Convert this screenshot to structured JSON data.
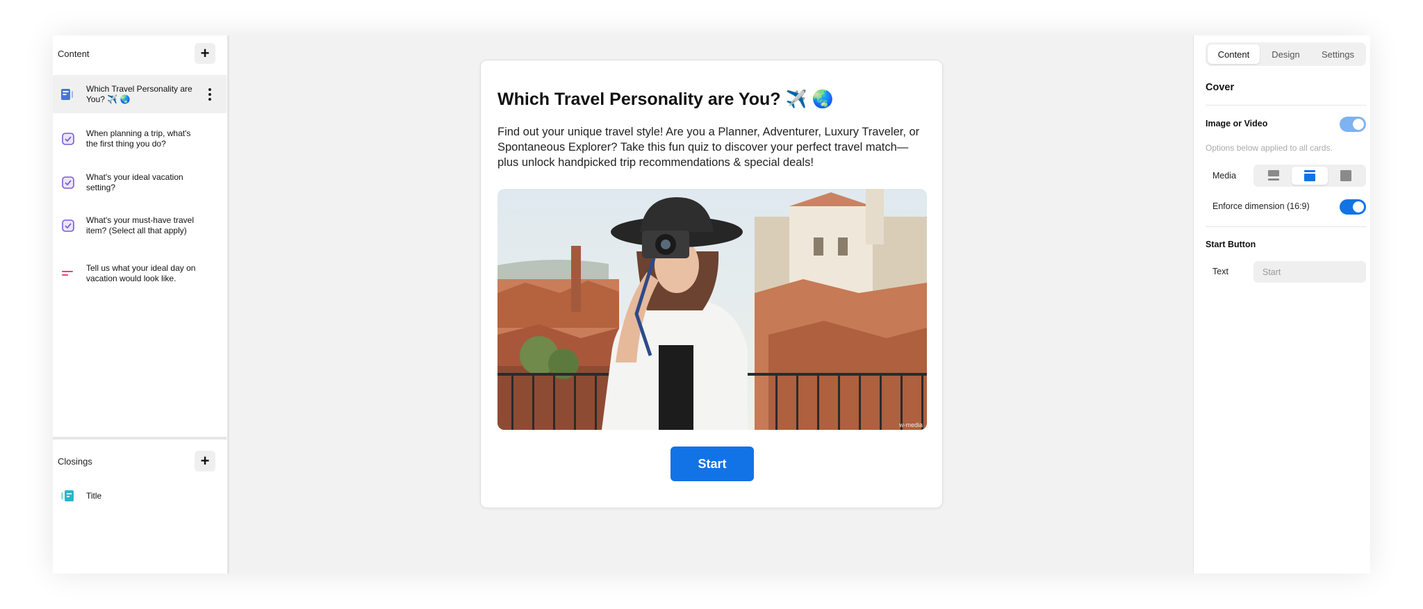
{
  "sidebar": {
    "content_heading": "Content",
    "items": [
      {
        "label": "Which Travel Personality are You? ✈️ 🌏",
        "icon": "cover-card-icon",
        "selected": true
      },
      {
        "label": "When planning a trip, what's the first thing you do?",
        "icon": "checkbox-question-icon"
      },
      {
        "label": "What's your ideal vacation setting?",
        "icon": "checkbox-question-icon"
      },
      {
        "label": "What's your must-have travel item? (Select all that apply)",
        "icon": "checkbox-question-icon"
      },
      {
        "label": "Tell us what your ideal day on vacation would look like.",
        "icon": "text-answer-icon"
      }
    ],
    "closings_heading": "Closings",
    "closings": [
      {
        "label": "Title",
        "icon": "closing-card-icon"
      }
    ]
  },
  "card": {
    "title": "Which Travel Personality are You? ✈️ 🌏",
    "description": "Find out your unique travel style! Are you a Planner, Adventurer, Luxury Traveler, or Spontaneous Explorer? Take this fun quiz to discover your perfect travel match—plus unlock handpicked trip recommendations & special deals!",
    "image_watermark": "w-media",
    "start_label": "Start"
  },
  "panel": {
    "tabs": [
      "Content",
      "Design",
      "Settings"
    ],
    "active_tab": "Content",
    "cover_heading": "Cover",
    "image_or_video_label": "Image or Video",
    "image_or_video_on": true,
    "options_hint": "Options below applied to all cards.",
    "media_label": "Media",
    "media_options": [
      "media-top-icon",
      "media-banner-icon",
      "media-full-icon"
    ],
    "media_selected": 1,
    "enforce_label": "Enforce dimension (16:9)",
    "enforce_on": true,
    "start_button_heading": "Start Button",
    "text_label": "Text",
    "text_placeholder": "Start"
  },
  "colors": {
    "accent": "#1273e6",
    "toggle_light": "#7fb2f0",
    "checkbox_purple": "#7a5cd6",
    "text_icon_pink": "#e0457b"
  }
}
